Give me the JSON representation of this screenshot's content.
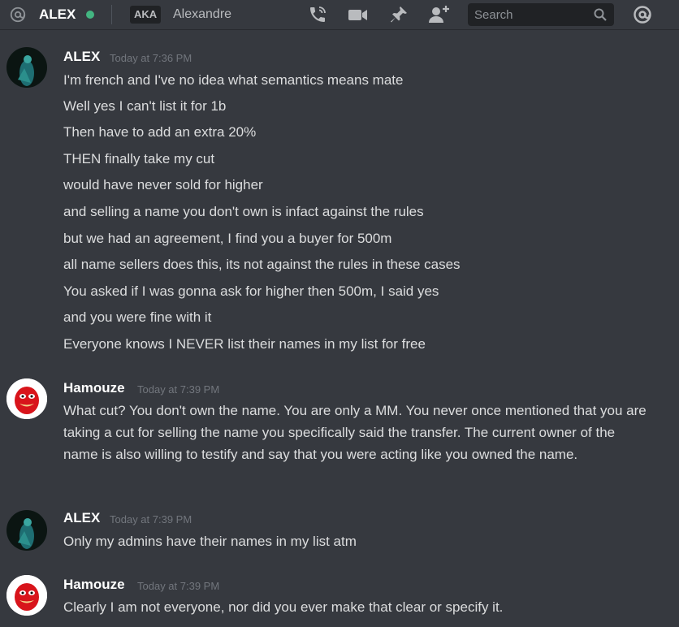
{
  "header": {
    "name": "ALEX",
    "aka_badge": "AKA",
    "alias": "Alexandre",
    "search_placeholder": "Search",
    "icons": [
      "at-icon",
      "call-icon",
      "video-icon",
      "pin-icon",
      "add-member-icon",
      "search-icon",
      "mention-icon"
    ],
    "status_color": "#43b581"
  },
  "messages": [
    {
      "author": "ALEX",
      "time": "Today at 7:36 PM",
      "lines": [
        "I'm french and I've no idea what semantics means mate",
        "Well yes I can't list it for 1b",
        "Then have to add an extra 20%",
        "THEN finally take my cut",
        "would have never sold for higher",
        "and selling a name you don't own is infact against the rules",
        "but we had an agreement, I find you a buyer for 500m",
        "all name sellers does this, its not against the rules in these cases",
        "You asked if I was gonna ask for higher then 500m, I said yes",
        "and you were fine with it",
        "Everyone knows I NEVER list their names in my list for free"
      ]
    },
    {
      "author": "Hamouze",
      "time": "Today at 7:39 PM",
      "lines": [
        "What cut? You don't own the name. You are only a MM. You never once mentioned that you are taking a cut for selling the name you specifically said the transfer. The current owner of the name is also willing to testify and say that you were acting like you owned the name."
      ]
    },
    {
      "author": "ALEX",
      "time": "Today at 7:39 PM",
      "lines": [
        "Only my admins have their names in my list atm"
      ]
    },
    {
      "author": "Hamouze",
      "time": "Today at 7:39 PM",
      "lines": [
        "Clearly I am not everyone, nor did you ever make that clear or specify it."
      ]
    }
  ]
}
